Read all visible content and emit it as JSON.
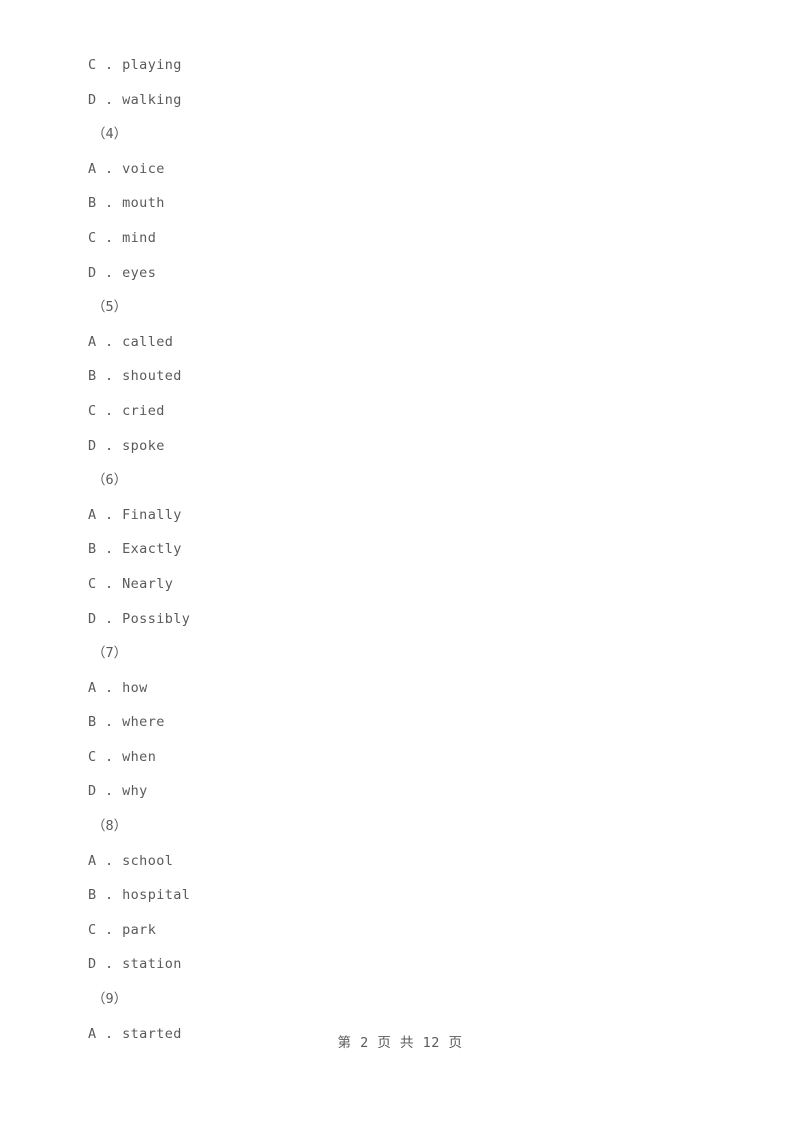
{
  "document": {
    "type": "exam-paper",
    "background_color": "#ffffff",
    "text_color": "#5a5a5a"
  },
  "lines": [
    {
      "kind": "option",
      "text": "C . playing"
    },
    {
      "kind": "option",
      "text": "D . walking"
    },
    {
      "kind": "qnum",
      "text": "（4）"
    },
    {
      "kind": "option",
      "text": "A . voice"
    },
    {
      "kind": "option",
      "text": "B . mouth"
    },
    {
      "kind": "option",
      "text": "C . mind"
    },
    {
      "kind": "option",
      "text": "D . eyes"
    },
    {
      "kind": "qnum",
      "text": "（5）"
    },
    {
      "kind": "option",
      "text": "A . called"
    },
    {
      "kind": "option",
      "text": "B . shouted"
    },
    {
      "kind": "option",
      "text": "C . cried"
    },
    {
      "kind": "option",
      "text": "D . spoke"
    },
    {
      "kind": "qnum",
      "text": "（6）"
    },
    {
      "kind": "option",
      "text": "A . Finally"
    },
    {
      "kind": "option",
      "text": "B . Exactly"
    },
    {
      "kind": "option",
      "text": "C . Nearly"
    },
    {
      "kind": "option",
      "text": "D . Possibly"
    },
    {
      "kind": "qnum",
      "text": "（7）"
    },
    {
      "kind": "option",
      "text": "A . how"
    },
    {
      "kind": "option",
      "text": "B . where"
    },
    {
      "kind": "option",
      "text": "C . when"
    },
    {
      "kind": "option",
      "text": "D . why"
    },
    {
      "kind": "qnum",
      "text": "（8）"
    },
    {
      "kind": "option",
      "text": "A . school"
    },
    {
      "kind": "option",
      "text": "B . hospital"
    },
    {
      "kind": "option",
      "text": "C . park"
    },
    {
      "kind": "option",
      "text": "D . station"
    },
    {
      "kind": "qnum",
      "text": "（9）"
    },
    {
      "kind": "option",
      "text": "A . started"
    }
  ],
  "footer": {
    "text": "第 2 页 共 12 页",
    "current_page": "2",
    "total_pages": "12"
  }
}
